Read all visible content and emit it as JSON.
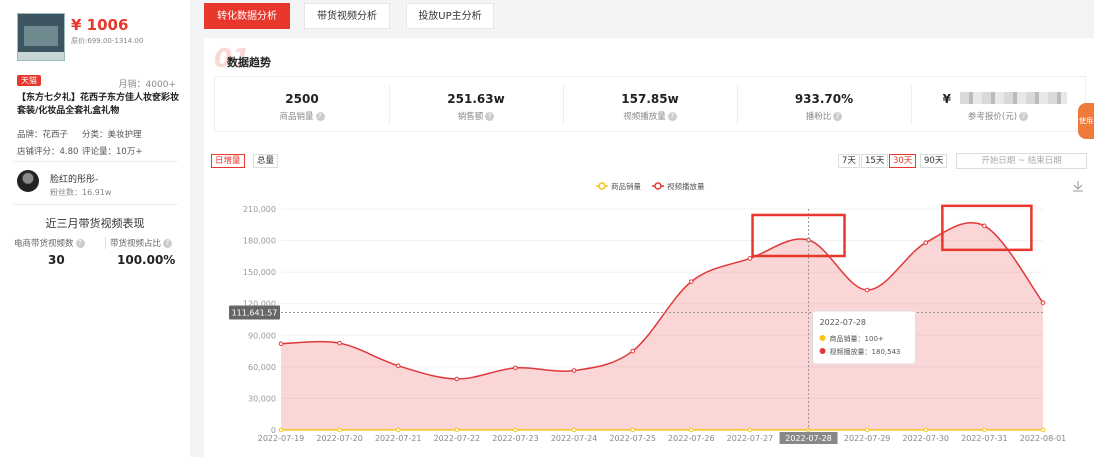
{
  "product": {
    "price": "¥ 1006",
    "price_range": "原价:699.00-1314.00",
    "store_badge": "天猫",
    "monthly_sales": "月销：4000+",
    "title": "【东方七夕礼】花西子东方佳人妆奁彩妆套装/化妆品全套礼盒礼物",
    "brand": "品牌：花西子",
    "category": "分类：美妆护理",
    "store_score": "店铺评分：4.80",
    "review_count": "评论量：10万+"
  },
  "influencer": {
    "name": "脸红的彤彤-",
    "fans": "粉丝数：16.91w"
  },
  "recent": {
    "title": "近三月带货视频表现",
    "label1": "电商带货视频数",
    "value1": "30",
    "label2": "带货视频占比",
    "value2": "100.00%"
  },
  "tabs": [
    "转化数据分析",
    "带货视频分析",
    "投放UP主分析"
  ],
  "panel": {
    "number": "01",
    "title": "数据趋势",
    "ribbon": "使用"
  },
  "stats": [
    {
      "value": "2500",
      "label": "商品销量"
    },
    {
      "value": "251.63w",
      "label": "销售额"
    },
    {
      "value": "157.85w",
      "label": "视频播放量"
    },
    {
      "value": "933.70%",
      "label": "播粉比"
    },
    {
      "value": "¥",
      "label": "参考报价(元)"
    }
  ],
  "toggles": [
    "日增量",
    "总量"
  ],
  "ranges": [
    "7天",
    "15天",
    "30天",
    "90天"
  ],
  "date_range": {
    "start": "开始日期",
    "sep": "~",
    "end": "结束日期"
  },
  "colors": {
    "accent": "#e8372c",
    "sales": "#f5c518",
    "views": "#e0383a"
  },
  "chart_data": {
    "type": "area",
    "x": [
      "2022-07-19",
      "2022-07-20",
      "2022-07-21",
      "2022-07-22",
      "2022-07-23",
      "2022-07-24",
      "2022-07-25",
      "2022-07-26",
      "2022-07-27",
      "2022-07-28",
      "2022-07-29",
      "2022-07-30",
      "2022-07-31",
      "2022-08-01"
    ],
    "series": [
      {
        "name": "商品销量",
        "values": [
          100,
          100,
          100,
          100,
          100,
          100,
          100,
          100,
          100,
          100,
          100,
          100,
          100,
          100
        ]
      },
      {
        "name": "视频播放量",
        "values": [
          82000,
          82500,
          61000,
          48500,
          59000,
          56500,
          75000,
          141000,
          163000,
          180543,
          133000,
          178000,
          194000,
          121000
        ]
      }
    ],
    "ylim": [
      0,
      210000
    ],
    "yticks": [
      "0",
      "30,000",
      "60,000",
      "90,000",
      "120,000",
      "150,000",
      "180,000",
      "210,000"
    ],
    "crosshair_value": "111,641.57",
    "highlight_x": "2022-07-28",
    "tooltip": {
      "date": "2022-07-28",
      "row1": "商品销量：100+",
      "row2": "视频播放量：180,543"
    }
  }
}
